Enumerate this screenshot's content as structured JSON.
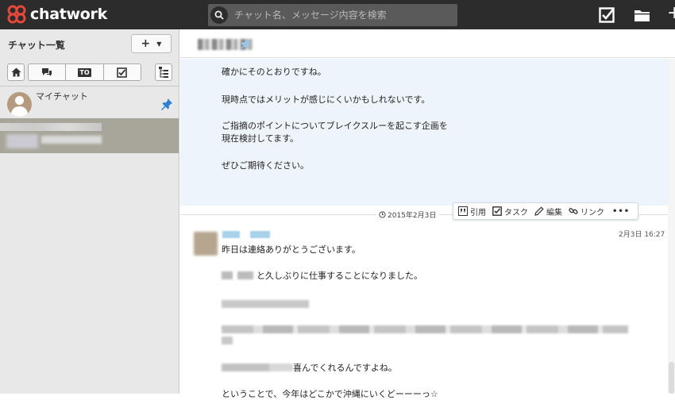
{
  "app": {
    "logo_text": "chatwork",
    "search_placeholder": "チャット名、メッセージ内容を検索",
    "brand_color": "#e2483b"
  },
  "sidebar": {
    "title": "チャット一覧",
    "add_label": "+",
    "filters": [
      "home-icon",
      "group-chat-icon",
      "to-icon",
      "task-check-icon",
      "tree-icon"
    ],
    "to_label": "TO",
    "rooms": [
      {
        "name": "マイチャット",
        "pinned": true
      }
    ]
  },
  "room": {
    "pinned": true
  },
  "messages": {
    "previous": {
      "lines": [
        "確かにそのとおりですね。",
        "現時点ではメリットが感じにくいかもしれないです。",
        "ご指摘のポイントについてブレイクスルーを起こす企画を",
        "現在検討してます。",
        "ぜひご期待ください。"
      ]
    },
    "date_divider": "2015年2月3日",
    "actions": {
      "quote": "引用",
      "task": "タスク",
      "edit": "編集",
      "link": "リンク",
      "more": "•••"
    },
    "current": {
      "timestamp": "2月3日 16:27",
      "line1": "昨日は連絡ありがとうございます。",
      "line2": "と久しぶりに仕事することになりました。",
      "line5": "喜んでくれるんですよね。",
      "line6": "ということで、今年はどこかで沖縄にいくどーーーっ☆"
    }
  }
}
